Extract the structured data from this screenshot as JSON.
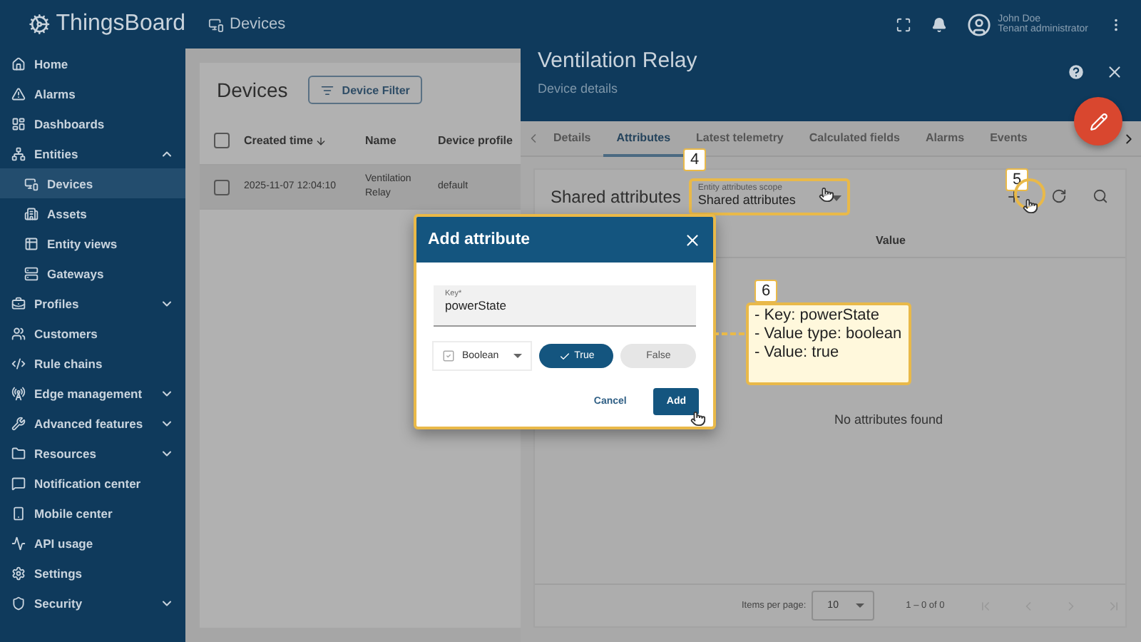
{
  "header": {
    "logo": "ThingsBoard",
    "breadcrumb": "Devices",
    "user": {
      "name": "John Doe",
      "role": "Tenant administrator"
    }
  },
  "sidebar": {
    "items": [
      {
        "label": "Home",
        "kind": "link",
        "selected": false
      },
      {
        "label": "Alarms",
        "kind": "link",
        "selected": false
      },
      {
        "label": "Dashboards",
        "kind": "link",
        "selected": false
      },
      {
        "label": "Entities",
        "kind": "group",
        "expanded": true,
        "selected": false,
        "children": [
          {
            "label": "Devices",
            "selected": true
          },
          {
            "label": "Assets",
            "selected": false
          },
          {
            "label": "Entity views",
            "selected": false
          },
          {
            "label": "Gateways",
            "selected": false
          }
        ]
      },
      {
        "label": "Profiles",
        "kind": "group",
        "expanded": false,
        "selected": false
      },
      {
        "label": "Customers",
        "kind": "link",
        "selected": false
      },
      {
        "label": "Rule chains",
        "kind": "link",
        "selected": false
      },
      {
        "label": "Edge management",
        "kind": "group",
        "expanded": false,
        "selected": false
      },
      {
        "label": "Advanced features",
        "kind": "group",
        "expanded": false,
        "selected": false
      },
      {
        "label": "Resources",
        "kind": "group",
        "expanded": false,
        "selected": false
      },
      {
        "label": "Notification center",
        "kind": "link",
        "selected": false
      },
      {
        "label": "Mobile center",
        "kind": "link",
        "selected": false
      },
      {
        "label": "API usage",
        "kind": "link",
        "selected": false
      },
      {
        "label": "Settings",
        "kind": "link",
        "selected": false
      },
      {
        "label": "Security",
        "kind": "group",
        "expanded": false,
        "selected": false
      }
    ]
  },
  "devices": {
    "title": "Devices",
    "filter_button": "Device Filter",
    "all_checked": false,
    "columns": [
      {
        "label": "Created time",
        "sorted": true
      },
      {
        "label": "Name",
        "sorted": false
      },
      {
        "label": "Device profile",
        "sorted": false
      }
    ],
    "rows": [
      {
        "selected": true,
        "checked": false,
        "cells": [
          "2025-11-07 12:04:10",
          "Ventilation Relay",
          "default"
        ]
      }
    ]
  },
  "details": {
    "title": "Ventilation Relay",
    "subtitle": "Device details",
    "tabs": [
      {
        "label": "Details",
        "selected": false
      },
      {
        "label": "Attributes",
        "selected": true
      },
      {
        "label": "Latest telemetry",
        "selected": false
      },
      {
        "label": "Calculated fields",
        "selected": false
      },
      {
        "label": "Alarms",
        "selected": false
      },
      {
        "label": "Events",
        "selected": false
      }
    ],
    "section_title": "Shared attributes",
    "scope": {
      "label": "Entity attributes scope",
      "value": "Shared attributes"
    },
    "columns": [
      "Value"
    ],
    "empty_text": "No attributes found",
    "paginator": {
      "label": "Items per page:",
      "page_size": "10",
      "range": "1 – 0 of 0"
    }
  },
  "dialog": {
    "title": "Add attribute",
    "key": {
      "label": "Key*",
      "value": "powerState"
    },
    "type": "Boolean",
    "options": [
      {
        "label": "True",
        "selected": true
      },
      {
        "label": "False",
        "selected": false
      }
    ],
    "buttons": [
      {
        "label": "Cancel",
        "kind": "text"
      },
      {
        "label": "Add",
        "kind": "primary"
      }
    ]
  },
  "annotations": [
    {
      "number": "4"
    },
    {
      "number": "5"
    },
    {
      "number": "6",
      "lines": [
        "- Key: powerState",
        "- Value type: boolean",
        "- Value: true"
      ]
    }
  ]
}
